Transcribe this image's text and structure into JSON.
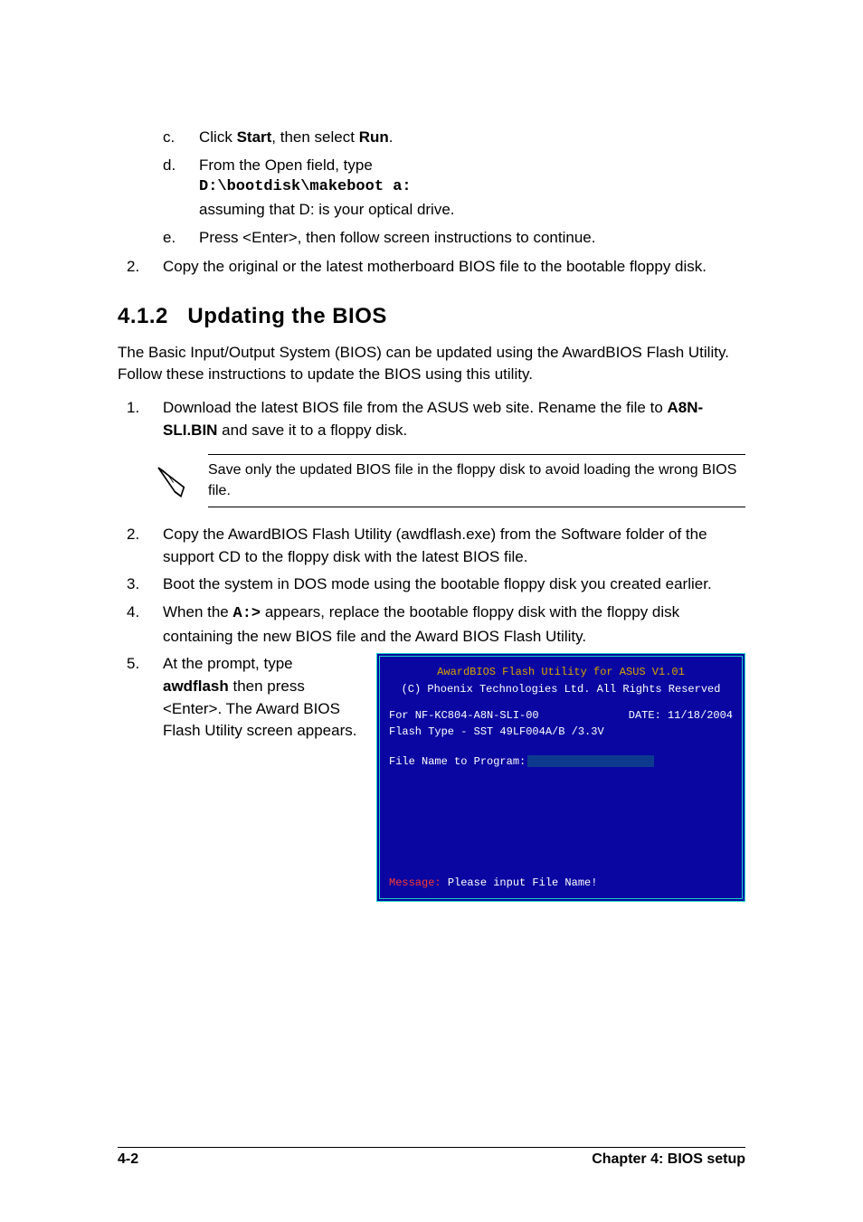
{
  "steps_top": {
    "c": {
      "text_prefix": "Click ",
      "bold1": "Start",
      "text_mid": ", then select ",
      "bold2": "Run",
      "text_suffix": "."
    },
    "d": {
      "text": "From the Open field, type",
      "code": "D:\\bootdisk\\makeboot a:",
      "after": "assuming that D: is your optical drive."
    },
    "e": "Press <Enter>, then follow screen instructions to continue.",
    "num2": "Copy the original or the latest motherboard BIOS file to the bootable floppy disk."
  },
  "section": {
    "number": "4.1.2",
    "title": "Updating the BIOS"
  },
  "intro": "The Basic Input/Output System (BIOS) can be updated using the AwardBIOS Flash Utility. Follow these instructions to update the BIOS using this utility.",
  "steps": {
    "s1": {
      "prefix": "Download the latest BIOS file from the ASUS web site. Rename the file to ",
      "bold": "A8N-SLI.BIN",
      "suffix": " and save it to a floppy disk."
    },
    "note": "Save only the updated BIOS file in the floppy disk to avoid loading the wrong BIOS file.",
    "s2": "Copy the AwardBIOS Flash Utility (awdflash.exe) from the Software folder of the support CD to the floppy disk with the latest BIOS file.",
    "s3": "Boot the system in DOS mode using the bootable floppy disk you created earlier.",
    "s4": {
      "prefix": "When the ",
      "bold": "A:>",
      "suffix": " appears, replace the bootable floppy disk with the floppy disk containing the new BIOS file and the Award BIOS Flash Utility."
    },
    "s5": {
      "prefix": "At the prompt, type ",
      "bold": "awdflash",
      "suffix": " then press <Enter>. The Award BIOS Flash Utility screen appears."
    }
  },
  "dos": {
    "title": "AwardBIOS Flash Utility for ASUS V1.01",
    "copyright": "(C) Phoenix Technologies Ltd. All Rights Reserved",
    "board": "For NF-KC804-A8N-SLI-00",
    "date_label": "DATE: ",
    "date": "11/18/2004",
    "flash_type": "Flash Type - SST 49LF004A/B /3.3V",
    "prompt_label": "File Name to Program:",
    "msg_label": "Message: ",
    "msg_text": "Please input File Name!"
  },
  "footer": {
    "left": "4-2",
    "right": "Chapter 4: BIOS setup"
  }
}
